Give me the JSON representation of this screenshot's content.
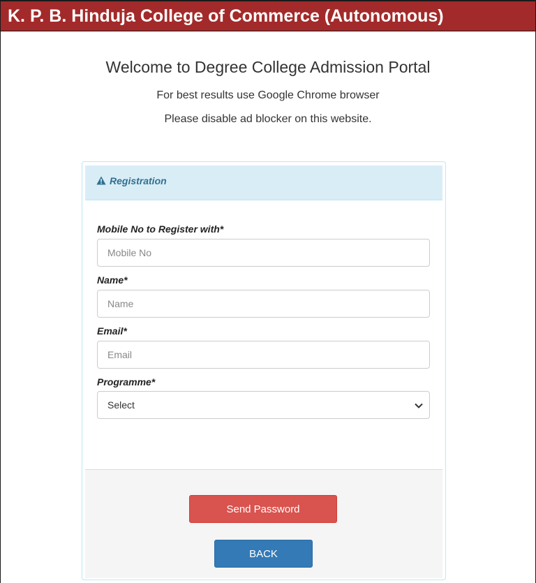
{
  "header": {
    "title": "K. P. B. Hinduja College of Commerce (Autonomous)"
  },
  "intro": {
    "welcome": "Welcome to Degree College Admission Portal",
    "browser_note": "For best results use Google Chrome browser",
    "adblock_note": "Please disable ad blocker on this website."
  },
  "panel": {
    "title": "Registration",
    "icon": "warning-icon"
  },
  "form": {
    "mobile": {
      "label": "Mobile No to Register with*",
      "placeholder": "Mobile No",
      "value": ""
    },
    "name": {
      "label": "Name*",
      "placeholder": "Name",
      "value": ""
    },
    "email": {
      "label": "Email*",
      "placeholder": "Email",
      "value": ""
    },
    "programme": {
      "label": "Programme*",
      "selected": "Select"
    }
  },
  "actions": {
    "send_label": "Send Password",
    "back_label": "BACK"
  },
  "colors": {
    "header_bg": "#a32a2a",
    "panel_heading_bg": "#d9edf7",
    "panel_heading_text": "#31708f",
    "danger": "#d9534f",
    "primary": "#337ab7"
  }
}
